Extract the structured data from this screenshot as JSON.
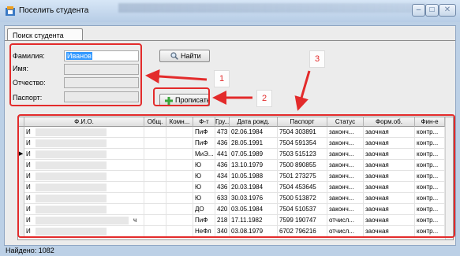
{
  "window": {
    "title": "Поселить студента",
    "min_icon": "minimize-icon",
    "max_icon": "maximize-icon",
    "close_icon": "close-icon"
  },
  "tabs": [
    {
      "label": "Поиск студента"
    }
  ],
  "form": {
    "lastname_label": "Фамилия:",
    "lastname_value": "Иванов",
    "firstname_label": "Имя:",
    "patronymic_label": "Отчество:",
    "passport_label": "Паспорт:",
    "find_button": "Найти",
    "add_button": "Прописать"
  },
  "callouts": [
    "1",
    "2",
    "3"
  ],
  "table": {
    "columns": [
      "Ф.И.О.",
      "Общ.",
      "Комн...",
      "Ф-т",
      "Гру...",
      "Дата рожд.",
      "Паспорт",
      "Статус",
      "Форм.об.",
      "Фин-е"
    ],
    "rows": [
      {
        "name": "И",
        "dorm": "",
        "room": "",
        "faculty": "ПиФ",
        "group": "473",
        "birth": "02.06.1984",
        "passport": "7504 303891",
        "status": "законч...",
        "form": "заочная",
        "fin": "контр..."
      },
      {
        "name": "И",
        "dorm": "",
        "room": "",
        "faculty": "ПиФ",
        "group": "436",
        "birth": "28.05.1991",
        "passport": "7504 591354",
        "status": "законч...",
        "form": "заочная",
        "fin": "контр..."
      },
      {
        "name": "И",
        "dorm": "",
        "room": "",
        "faculty": "МиЭ...",
        "group": "441",
        "birth": "07.05.1989",
        "passport": "7503 515123",
        "status": "законч...",
        "form": "заочная",
        "fin": "контр..."
      },
      {
        "name": "И",
        "dorm": "",
        "room": "",
        "faculty": "Ю",
        "group": "436",
        "birth": "13.10.1979",
        "passport": "7500 890855",
        "status": "законч...",
        "form": "заочная",
        "fin": "контр..."
      },
      {
        "name": "И",
        "dorm": "",
        "room": "",
        "faculty": "Ю",
        "group": "434",
        "birth": "10.05.1988",
        "passport": "7501 273275",
        "status": "законч...",
        "form": "заочная",
        "fin": "контр..."
      },
      {
        "name": "И",
        "dorm": "",
        "room": "",
        "faculty": "Ю",
        "group": "436",
        "birth": "20.03.1984",
        "passport": "7504 453645",
        "status": "законч...",
        "form": "заочная",
        "fin": "контр..."
      },
      {
        "name": "И",
        "dorm": "",
        "room": "",
        "faculty": "Ю",
        "group": "633",
        "birth": "30.03.1976",
        "passport": "7500 513872",
        "status": "законч...",
        "form": "заочная",
        "fin": "контр..."
      },
      {
        "name": "И",
        "dorm": "",
        "room": "",
        "faculty": "ДО",
        "group": "420",
        "birth": "03.05.1984",
        "passport": "7504 510537",
        "status": "законч...",
        "form": "заочная",
        "fin": "контр..."
      },
      {
        "name": "И",
        "name_tail": "ч",
        "dorm": "",
        "room": "",
        "faculty": "ПиФ",
        "group": "218",
        "birth": "17.11.1982",
        "passport": "7599 190747",
        "status": "отчисл...",
        "form": "заочная",
        "fin": "контр..."
      },
      {
        "name": "И",
        "dorm": "",
        "room": "",
        "faculty": "НеФл",
        "group": "340",
        "birth": "03.08.1979",
        "passport": "6702 796216",
        "status": "отчисл...",
        "form": "заочная",
        "fin": "контр..."
      }
    ]
  },
  "status": {
    "found": "Найдено: 1082"
  },
  "colors": {
    "highlight": "#e32b2b",
    "selection": "#3399ff",
    "frame": "#bcd0e6"
  }
}
